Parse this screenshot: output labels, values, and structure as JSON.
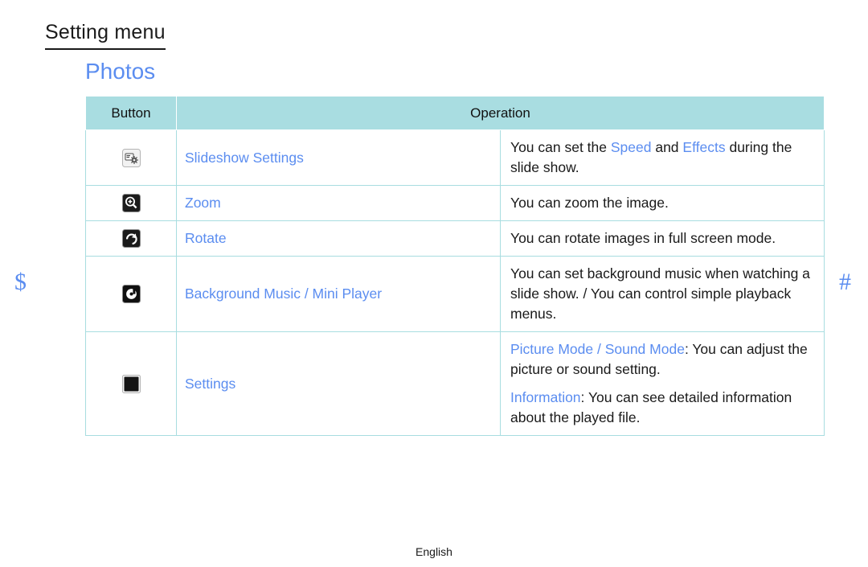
{
  "page": {
    "heading": "Setting menu",
    "section_title": "Photos",
    "footer_language": "English",
    "left_marker": "$",
    "right_marker": "#",
    "accent_blue": "#5b8df0",
    "header_teal": "#a9dde1",
    "border_teal": "#a8dde0"
  },
  "table": {
    "headers": {
      "button": "Button",
      "operation": "Operation"
    },
    "rows": [
      {
        "icon": "slideshow-settings-icon",
        "label": "Slideshow Settings",
        "description_parts": [
          [
            {
              "text": "You can set the ",
              "accent": false
            },
            {
              "text": "Speed",
              "accent": true
            },
            {
              "text": " and ",
              "accent": false
            },
            {
              "text": "Effects",
              "accent": true
            },
            {
              "text": " during the slide show.",
              "accent": false
            }
          ]
        ]
      },
      {
        "icon": "zoom-icon",
        "label": "Zoom",
        "description_parts": [
          [
            {
              "text": "You can zoom the image.",
              "accent": false
            }
          ]
        ]
      },
      {
        "icon": "rotate-icon",
        "label": "Rotate",
        "description_parts": [
          [
            {
              "text": "You can rotate images in full screen mode.",
              "accent": false
            }
          ]
        ]
      },
      {
        "icon": "background-music-icon",
        "label": "Background Music / Mini Player",
        "description_parts": [
          [
            {
              "text": "You can set background music when watching a slide show. / You can control simple playback menus.",
              "accent": false
            }
          ]
        ]
      },
      {
        "icon": "settings-icon",
        "label": "Settings",
        "description_parts": [
          [
            {
              "text": "Picture Mode / Sound Mode",
              "accent": true
            },
            {
              "text": ": You can adjust the picture or sound setting.",
              "accent": false
            }
          ],
          [
            {
              "text": "Information",
              "accent": true
            },
            {
              "text": ": You can see detailed information about the played file.",
              "accent": false
            }
          ]
        ]
      }
    ]
  }
}
